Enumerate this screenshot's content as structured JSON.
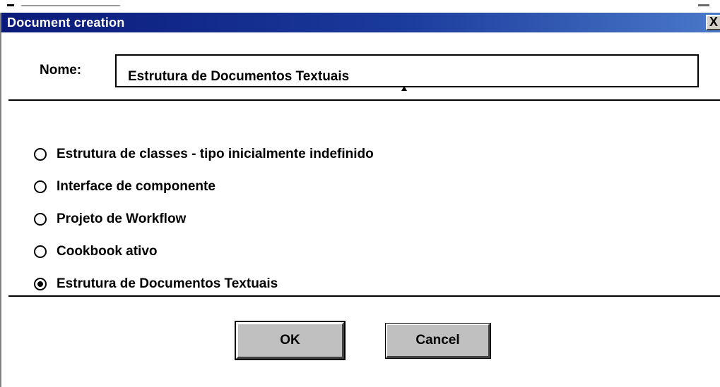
{
  "dialog": {
    "title": "Document creation",
    "close_label": "X",
    "nome_label": "Nome:",
    "nome_value": "Estrutura de Documentos Textuais"
  },
  "options": [
    {
      "label": "Estrutura de classes - tipo inicialmente indefinido",
      "selected": false
    },
    {
      "label": "Interface de componente",
      "selected": false
    },
    {
      "label": "Projeto de Workflow",
      "selected": false
    },
    {
      "label": "Cookbook ativo",
      "selected": false
    },
    {
      "label": "Estrutura de Documentos Textuais",
      "selected": true
    }
  ],
  "buttons": {
    "ok_label": "OK",
    "cancel_label": "Cancel"
  },
  "colors": {
    "titlebar_start": "#0a1a7a",
    "titlebar_end": "#4a78c8",
    "button_face": "#c0c0c0"
  }
}
